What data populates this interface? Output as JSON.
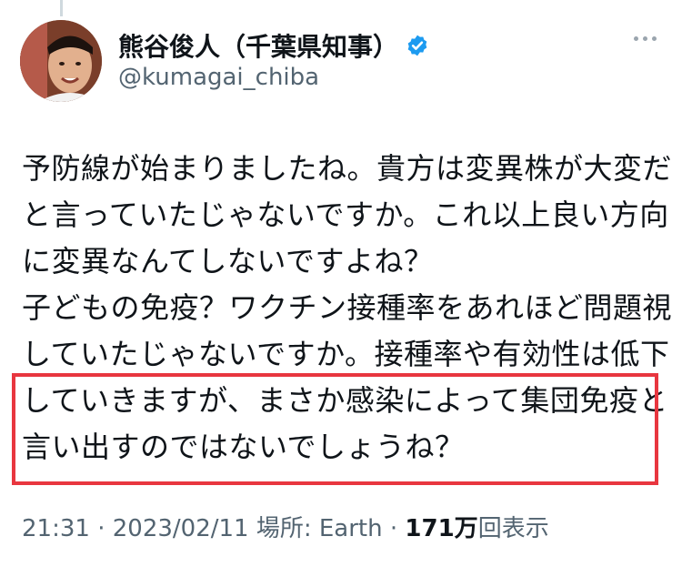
{
  "author": {
    "display_name": "熊谷俊人（千葉県知事）",
    "handle": "@kumagai_chiba",
    "verified_icon": "verified-badge-icon",
    "verified_color": "#1d9bf0"
  },
  "tweet": {
    "lines": [
      "予防線が始まりましたね。貴方は変異株が大変だ",
      "と言っていたじゃないですか。これ以上良い方向",
      "に変異なんてしないですよね？",
      "子どもの免疫？ワクチン接種率をあれほど問題視",
      "していたじゃないですか。接種率や有効性は低下",
      "していきますが、まさか感染によって集団免疫と",
      "言い出すのではないでしょうね？"
    ],
    "highlight_color": "#e8363f"
  },
  "meta": {
    "time": "21:31",
    "sep1": " · ",
    "date": "2023/02/11",
    "location": " 場所: Earth",
    "sep2": " · ",
    "views_count": "171万",
    "views_label": "回表示"
  },
  "icons": {
    "more": "more-icon",
    "avatar": "avatar"
  }
}
